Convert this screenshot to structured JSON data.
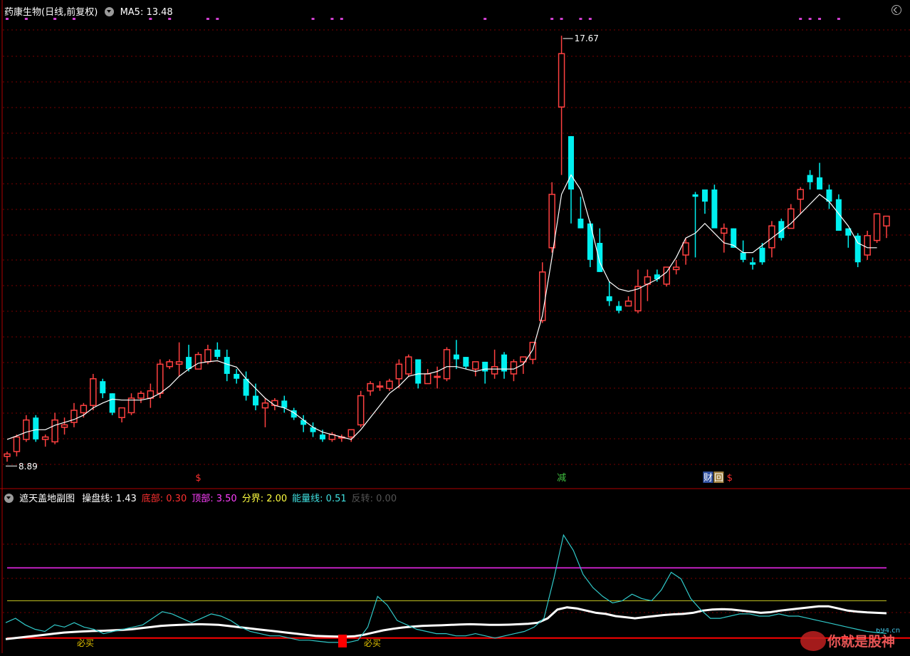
{
  "header": {
    "title": "药康生物(日线,前复权)",
    "ma_label": "MA5: 13.48",
    "sub_title": "遮天盖地副图",
    "sub_items": [
      {
        "label": "操盘线: 1.43",
        "color": "#ffffff"
      },
      {
        "label": "底部: 0.30",
        "color": "#ff3030"
      },
      {
        "label": "顶部: 3.50",
        "color": "#ff40ff"
      },
      {
        "label": "分界: 2.00",
        "color": "#ffff40"
      },
      {
        "label": "能量线: 0.51",
        "color": "#40e0e0"
      },
      {
        "label": "反转: 0.00",
        "color": "#555555"
      }
    ]
  },
  "annotations": {
    "high_label": "17.67",
    "low_label": "8.89",
    "signals": [
      {
        "text": "$",
        "color": "#ff3030"
      },
      {
        "text": "减",
        "color": "#40c040"
      },
      {
        "text": "财",
        "color": "#ffffff",
        "bg": "#3050a0"
      },
      {
        "text": "回",
        "color": "#ffffff",
        "bg": "#a08040"
      },
      {
        "text": "$",
        "color": "#ff3030"
      }
    ],
    "buy_labels": [
      "必买",
      "必买"
    ],
    "watermark": "你就是股神",
    "watermark_site": "694.cn"
  },
  "colors": {
    "up": "#ff4040",
    "down": "#00f0f0",
    "ma": "#ffffff",
    "grid": "#7a0000",
    "purple_dots": "#d040d0"
  },
  "chart_data": [
    {
      "type": "candlestick",
      "title": "药康生物(日线,前复权)",
      "price_range": [
        8.89,
        17.67
      ],
      "ylim": [
        8.6,
        18.2
      ],
      "series": [
        {
          "name": "K线",
          "ohlc": [
            [
              9.0,
              9.1,
              8.89,
              9.05
            ],
            [
              9.1,
              9.45,
              9.0,
              9.4
            ],
            [
              9.35,
              9.85,
              9.3,
              9.75
            ],
            [
              9.8,
              9.85,
              9.3,
              9.35
            ],
            [
              9.35,
              9.45,
              9.2,
              9.4
            ],
            [
              9.3,
              9.9,
              9.25,
              9.75
            ],
            [
              9.6,
              9.8,
              9.45,
              9.65
            ],
            [
              9.7,
              10.1,
              9.6,
              9.95
            ],
            [
              9.9,
              10.1,
              9.8,
              10.05
            ],
            [
              10.05,
              10.7,
              9.95,
              10.6
            ],
            [
              10.55,
              10.6,
              10.2,
              10.3
            ],
            [
              10.3,
              10.3,
              9.85,
              9.9
            ],
            [
              9.8,
              10.0,
              9.7,
              10.0
            ],
            [
              9.9,
              10.3,
              9.85,
              10.2
            ],
            [
              10.2,
              10.35,
              10.1,
              10.3
            ],
            [
              10.2,
              10.5,
              10.0,
              10.35
            ],
            [
              10.3,
              11.0,
              10.2,
              10.9
            ],
            [
              10.85,
              11.0,
              10.8,
              10.95
            ],
            [
              10.9,
              11.35,
              10.65,
              10.95
            ],
            [
              11.05,
              11.3,
              10.75,
              10.8
            ],
            [
              10.8,
              11.15,
              10.8,
              11.1
            ],
            [
              10.95,
              11.3,
              10.9,
              11.2
            ],
            [
              11.2,
              11.35,
              11.0,
              11.05
            ],
            [
              11.05,
              11.2,
              10.55,
              10.7
            ],
            [
              10.7,
              10.8,
              10.5,
              10.6
            ],
            [
              10.6,
              10.75,
              10.15,
              10.25
            ],
            [
              10.25,
              10.5,
              9.95,
              10.05
            ],
            [
              10.0,
              10.2,
              9.6,
              10.1
            ],
            [
              10.05,
              10.2,
              9.95,
              10.15
            ],
            [
              10.15,
              10.25,
              9.9,
              10.0
            ],
            [
              9.95,
              10.0,
              9.75,
              9.8
            ],
            [
              9.75,
              9.85,
              9.5,
              9.65
            ],
            [
              9.6,
              9.7,
              9.4,
              9.5
            ],
            [
              9.45,
              9.55,
              9.3,
              9.35
            ],
            [
              9.35,
              9.5,
              9.3,
              9.45
            ],
            [
              9.4,
              9.45,
              9.3,
              9.4
            ],
            [
              9.4,
              9.55,
              9.3,
              9.55
            ],
            [
              9.65,
              10.35,
              9.6,
              10.25
            ],
            [
              10.35,
              10.55,
              10.25,
              10.5
            ],
            [
              10.45,
              10.55,
              10.35,
              10.45
            ],
            [
              10.4,
              10.6,
              10.35,
              10.55
            ],
            [
              10.6,
              11.0,
              10.4,
              10.9
            ],
            [
              10.7,
              11.1,
              10.65,
              11.05
            ],
            [
              11.0,
              11.0,
              10.4,
              10.5
            ],
            [
              10.5,
              10.8,
              10.5,
              10.7
            ],
            [
              10.65,
              10.85,
              10.4,
              10.65
            ],
            [
              10.6,
              11.25,
              10.55,
              11.2
            ],
            [
              11.1,
              11.4,
              10.8,
              11.0
            ],
            [
              11.05,
              11.05,
              10.8,
              10.85
            ],
            [
              10.8,
              10.95,
              10.65,
              10.95
            ],
            [
              10.95,
              10.95,
              10.5,
              10.75
            ],
            [
              10.7,
              11.2,
              10.6,
              10.85
            ],
            [
              11.1,
              11.15,
              10.6,
              10.75
            ],
            [
              10.7,
              11.0,
              10.55,
              10.95
            ],
            [
              10.95,
              11.05,
              10.7,
              11.05
            ],
            [
              11.0,
              11.35,
              10.9,
              11.35
            ],
            [
              11.8,
              13.0,
              11.75,
              12.8
            ],
            [
              13.3,
              14.65,
              13.2,
              14.4
            ],
            [
              16.2,
              17.67,
              14.8,
              17.3
            ],
            [
              15.6,
              15.6,
              13.8,
              14.5
            ],
            [
              13.9,
              14.35,
              13.7,
              13.7
            ],
            [
              13.8,
              13.85,
              12.9,
              13.05
            ],
            [
              13.4,
              13.7,
              12.8,
              12.8
            ],
            [
              12.3,
              12.6,
              12.1,
              12.2
            ],
            [
              12.1,
              12.2,
              11.95,
              12.0
            ],
            [
              12.1,
              12.3,
              12.1,
              12.2
            ],
            [
              12.0,
              12.85,
              11.95,
              12.5
            ],
            [
              12.55,
              12.85,
              12.2,
              12.7
            ],
            [
              12.75,
              12.85,
              12.6,
              12.65
            ],
            [
              12.55,
              12.9,
              12.5,
              12.9
            ],
            [
              12.85,
              13.05,
              12.75,
              12.9
            ],
            [
              13.15,
              13.5,
              12.95,
              13.4
            ],
            [
              14.4,
              14.45,
              13.1,
              14.35
            ],
            [
              14.5,
              14.35,
              14.0,
              14.25
            ],
            [
              14.5,
              14.6,
              14.1,
              13.7
            ],
            [
              13.6,
              13.8,
              13.2,
              13.7
            ],
            [
              13.7,
              13.7,
              13.3,
              13.3
            ],
            [
              13.2,
              13.45,
              13.0,
              13.05
            ],
            [
              13.0,
              13.1,
              12.85,
              12.95
            ],
            [
              13.3,
              13.4,
              12.95,
              13.0
            ],
            [
              13.3,
              13.85,
              13.1,
              13.75
            ],
            [
              13.85,
              13.9,
              13.45,
              13.5
            ],
            [
              13.7,
              14.2,
              13.7,
              14.1
            ],
            [
              14.3,
              14.55,
              14.0,
              14.5
            ],
            [
              14.8,
              14.9,
              14.5,
              14.65
            ],
            [
              14.75,
              15.05,
              14.6,
              14.5
            ],
            [
              14.5,
              14.6,
              14.1,
              14.25
            ],
            [
              14.3,
              14.4,
              13.7,
              13.65
            ],
            [
              13.7,
              13.7,
              13.3,
              13.55
            ],
            [
              13.55,
              13.6,
              12.9,
              13.0
            ],
            [
              13.15,
              13.65,
              13.05,
              13.55
            ],
            [
              13.45,
              14.0,
              13.4,
              14.0
            ],
            [
              13.75,
              13.9,
              13.5,
              13.95
            ]
          ]
        },
        {
          "name": "MA5",
          "values": [
            9.35,
            9.42,
            9.5,
            9.55,
            9.55,
            9.64,
            9.7,
            9.76,
            9.85,
            10.0,
            10.1,
            10.18,
            10.16,
            10.16,
            10.16,
            10.2,
            10.3,
            10.45,
            10.65,
            10.8,
            10.92,
            10.95,
            10.97,
            10.9,
            10.84,
            10.6,
            10.4,
            10.2,
            10.05,
            10.0,
            9.9,
            9.75,
            9.6,
            9.5,
            9.45,
            9.4,
            9.35,
            9.55,
            9.8,
            10.05,
            10.3,
            10.45,
            10.65,
            10.7,
            10.7,
            10.75,
            10.85,
            10.85,
            10.8,
            10.75,
            10.8,
            10.8,
            10.8,
            10.8,
            10.9,
            11.2,
            11.9,
            13.1,
            14.4,
            14.8,
            14.5,
            13.8,
            13.0,
            12.6,
            12.45,
            12.4,
            12.45,
            12.55,
            12.65,
            12.8,
            13.1,
            13.5,
            13.6,
            13.8,
            13.6,
            13.4,
            13.35,
            13.2,
            13.2,
            13.35,
            13.5,
            13.65,
            13.8,
            14.0,
            14.2,
            14.4,
            14.25,
            14.0,
            13.75,
            13.4,
            13.3,
            13.3
          ]
        }
      ]
    },
    {
      "type": "line",
      "title": "遮天盖地副图",
      "ylim": [
        0,
        6.5
      ],
      "reference_lines": [
        {
          "name": "顶部",
          "value": 3.5
        },
        {
          "name": "分界",
          "value": 2.0
        },
        {
          "name": "底部",
          "value": 0.3
        }
      ],
      "series": [
        {
          "name": "操盘线",
          "values": [
            0.25,
            0.3,
            0.35,
            0.4,
            0.45,
            0.5,
            0.55,
            0.58,
            0.6,
            0.62,
            0.63,
            0.65,
            0.67,
            0.7,
            0.75,
            0.8,
            0.85,
            0.88,
            0.9,
            0.92,
            0.93,
            0.92,
            0.9,
            0.85,
            0.8,
            0.75,
            0.7,
            0.65,
            0.6,
            0.55,
            0.5,
            0.45,
            0.4,
            0.38,
            0.37,
            0.36,
            0.38,
            0.45,
            0.55,
            0.65,
            0.72,
            0.78,
            0.82,
            0.85,
            0.87,
            0.88,
            0.9,
            0.92,
            0.93,
            0.92,
            0.9,
            0.9,
            0.91,
            0.93,
            0.95,
            1.0,
            1.2,
            1.6,
            1.7,
            1.65,
            1.55,
            1.45,
            1.4,
            1.3,
            1.25,
            1.2,
            1.25,
            1.3,
            1.35,
            1.38,
            1.4,
            1.45,
            1.55,
            1.6,
            1.62,
            1.6,
            1.55,
            1.5,
            1.45,
            1.48,
            1.55,
            1.6,
            1.65,
            1.7,
            1.75,
            1.75,
            1.65,
            1.55,
            1.5,
            1.47,
            1.45,
            1.43
          ]
        },
        {
          "name": "能量线",
          "values": [
            1.0,
            1.2,
            0.9,
            0.7,
            0.6,
            0.9,
            0.8,
            1.0,
            0.8,
            0.7,
            0.5,
            0.6,
            0.7,
            0.8,
            0.9,
            1.2,
            1.5,
            1.4,
            1.2,
            1.0,
            1.2,
            1.4,
            1.3,
            1.1,
            0.8,
            0.6,
            0.5,
            0.4,
            0.4,
            0.3,
            0.2,
            0.2,
            0.15,
            0.1,
            0.1,
            0.1,
            0.2,
            0.8,
            2.2,
            1.8,
            1.1,
            0.9,
            0.7,
            0.6,
            0.5,
            0.5,
            0.4,
            0.4,
            0.5,
            0.4,
            0.3,
            0.4,
            0.5,
            0.6,
            0.8,
            1.2,
            3.0,
            5.0,
            4.3,
            3.2,
            2.6,
            2.2,
            1.9,
            2.0,
            2.3,
            2.1,
            2.0,
            2.5,
            3.3,
            3.0,
            2.1,
            1.6,
            1.2,
            1.2,
            1.3,
            1.4,
            1.4,
            1.3,
            1.3,
            1.4,
            1.3,
            1.3,
            1.2,
            1.1,
            1.0,
            0.9,
            0.8,
            0.7,
            0.6,
            0.55,
            0.51
          ]
        }
      ]
    }
  ]
}
